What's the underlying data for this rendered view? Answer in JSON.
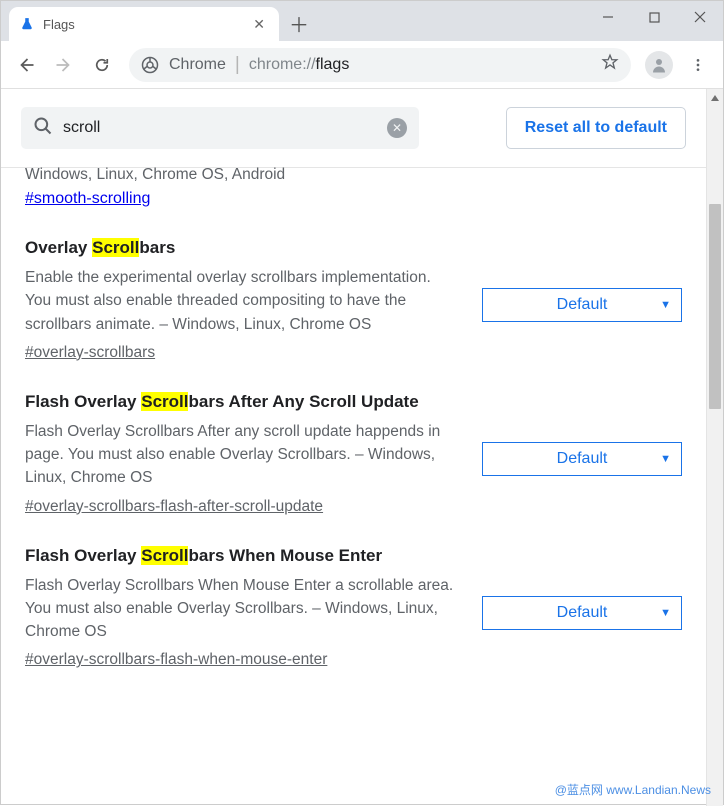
{
  "tab": {
    "title": "Flags"
  },
  "omnibox": {
    "label": "Chrome",
    "urlPrefix": "chrome://",
    "urlPath": "flags"
  },
  "search": {
    "query": "scroll"
  },
  "resetButton": "Reset all to default",
  "partial": {
    "truncated_line": "Windows, Linux, Chrome OS, Android",
    "anchor": "#smooth-scrolling"
  },
  "flags": [
    {
      "title_pre": "Overlay ",
      "title_hl": "Scroll",
      "title_post": "bars",
      "description": "Enable the experimental overlay scrollbars implementation. You must also enable threaded compositing to have the scrollbars animate. – Windows, Linux, Chrome OS",
      "anchor": "#overlay-scrollbars",
      "select": "Default"
    },
    {
      "title_pre": "Flash Overlay ",
      "title_hl": "Scroll",
      "title_post": "bars After Any Scroll Update",
      "description": "Flash Overlay Scrollbars After any scroll update happends in page. You must also enable Overlay Scrollbars. – Windows, Linux, Chrome OS",
      "anchor": "#overlay-scrollbars-flash-after-scroll-update",
      "select": "Default"
    },
    {
      "title_pre": "Flash Overlay ",
      "title_hl": "Scroll",
      "title_post": "bars When Mouse Enter",
      "description": "Flash Overlay Scrollbars When Mouse Enter a scrollable area. You must also enable Overlay Scrollbars. – Windows, Linux, Chrome OS",
      "anchor": "#overlay-scrollbars-flash-when-mouse-enter",
      "select": "Default"
    }
  ],
  "watermark": "@蓝点网 www.Landian.News"
}
